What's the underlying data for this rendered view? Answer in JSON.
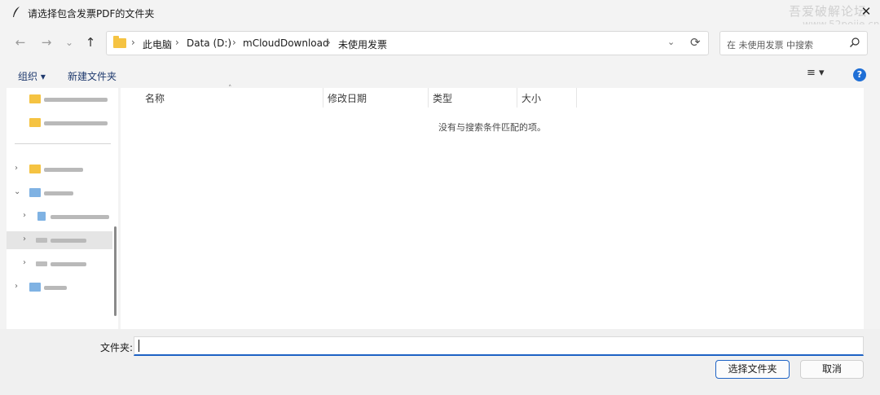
{
  "window": {
    "title": "请选择包含发票PDF的文件夹",
    "close_glyph": "✕"
  },
  "watermark": {
    "line1": "吾爱破解论坛",
    "line2": "www.52pojie.cn"
  },
  "nav": {
    "back_glyph": "←",
    "forward_glyph": "→",
    "recent_glyph": "⌄",
    "up_glyph": "↑"
  },
  "address": {
    "breadcrumbs": [
      "此电脑",
      "Data (D:)",
      "mCloudDownload",
      "未使用发票"
    ],
    "separator": "›",
    "dropdown_glyph": "⌄",
    "refresh_glyph": "⟳"
  },
  "search": {
    "placeholder": "在 未使用发票 中搜索"
  },
  "commands": {
    "organize": "组织 ▾",
    "new_folder": "新建文件夹",
    "view_glyph": "≡ ▾",
    "help_glyph": "?"
  },
  "columns": [
    "名称",
    "修改日期",
    "类型",
    "大小"
  ],
  "sort_glyph": "˄",
  "empty_message": "没有与搜索条件匹配的项。",
  "footer": {
    "folder_label": "文件夹:",
    "folder_value": "",
    "select_button": "选择文件夹",
    "cancel_button": "取消"
  },
  "icons": {
    "title": "feather-icon",
    "search": "search-icon",
    "help": "help-icon"
  },
  "colors": {
    "accent": "#1d62c4",
    "folder": "#f5c342",
    "help": "#1f6fd6"
  }
}
